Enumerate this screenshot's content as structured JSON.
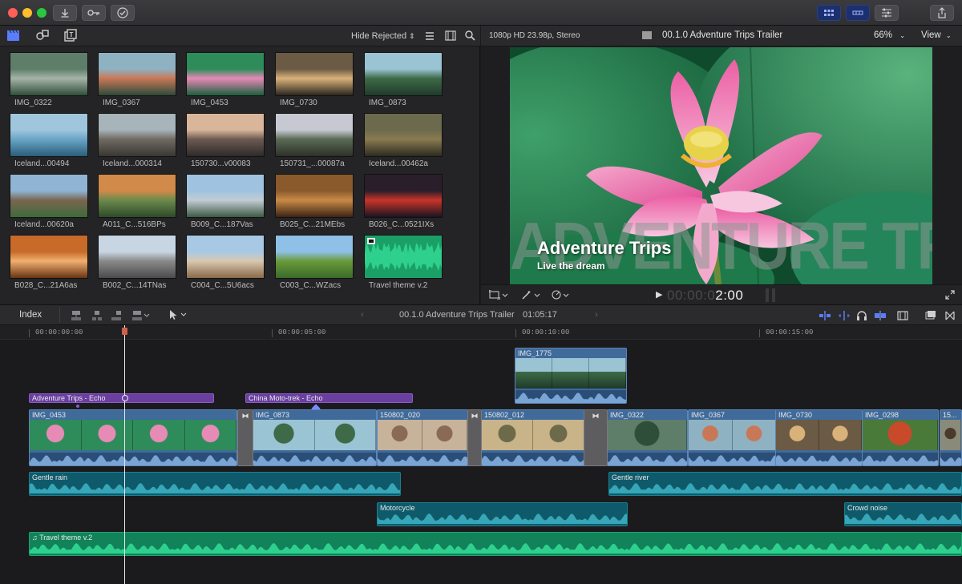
{
  "window": {
    "colors": {
      "close": "#ff5f57",
      "minimize": "#febc2e",
      "zoom": "#28c840",
      "accent": "#2c3f80"
    }
  },
  "toolbar": {
    "icons": [
      "import-icon",
      "key-icon",
      "check-icon",
      "browser-layout-icon",
      "timeline-layout-icon",
      "inspector-icon",
      "share-icon"
    ]
  },
  "browser": {
    "filter_label": "Hide Rejected",
    "clips": [
      {
        "label": "IMG_0322",
        "colors": [
          "#5f7e6a",
          "#a5b4a8",
          "#2f4e3a"
        ]
      },
      {
        "label": "IMG_0367",
        "colors": [
          "#8fb2c2",
          "#c87856",
          "#2d4a3b"
        ]
      },
      {
        "label": "IMG_0453",
        "colors": [
          "#2e8c5a",
          "#e68ab6",
          "#1b5f3d"
        ]
      },
      {
        "label": "IMG_0730",
        "colors": [
          "#6b5a44",
          "#d9b27a",
          "#2b2520"
        ]
      },
      {
        "label": "IMG_0873",
        "colors": [
          "#9ac3d4",
          "#3e6a48",
          "#1f3a2a"
        ]
      },
      {
        "label": "Iceland...00494",
        "colors": [
          "#9fc6dc",
          "#6aa5c7",
          "#2a5d7a"
        ]
      },
      {
        "label": "Iceland...000314",
        "colors": [
          "#a7b4b9",
          "#6f6a62",
          "#3a3632"
        ]
      },
      {
        "label": "150730...v00083",
        "colors": [
          "#d9b69a",
          "#6d5a52",
          "#2d2a2a"
        ]
      },
      {
        "label": "150731_...00087a",
        "colors": [
          "#c7c9d2",
          "#5a6a55",
          "#2d3129"
        ]
      },
      {
        "label": "Iceland...00462a",
        "colors": [
          "#6c6a4c",
          "#8a7a50",
          "#2c2b20"
        ]
      },
      {
        "label": "Iceland...00620a",
        "colors": [
          "#8fb4d4",
          "#7a6650",
          "#3e6a3a"
        ]
      },
      {
        "label": "A011_C...516BPs",
        "colors": [
          "#d18a4a",
          "#6b8a4c",
          "#2e4a2a"
        ]
      },
      {
        "label": "B009_C...187Vas",
        "colors": [
          "#9fc2e0",
          "#c2ccd4",
          "#3d5a44"
        ]
      },
      {
        "label": "B025_C...21MEbs",
        "colors": [
          "#8a5a2c",
          "#c98a48",
          "#3b2414"
        ]
      },
      {
        "label": "B026_C...0521IXs",
        "colors": [
          "#2a1e2a",
          "#c8342a",
          "#1a1420"
        ]
      },
      {
        "label": "B028_C...21A6as",
        "colors": [
          "#c86a2a",
          "#f0b070",
          "#6a3414"
        ]
      },
      {
        "label": "B002_C...14TNas",
        "colors": [
          "#c8d6e4",
          "#8a8a8a",
          "#4a4a4a"
        ]
      },
      {
        "label": "C004_C...5U6acs",
        "colors": [
          "#a7c9e4",
          "#d8c8b0",
          "#8a6a4a"
        ]
      },
      {
        "label": "C003_C...WZacs",
        "colors": [
          "#8fc0e8",
          "#6a9a3a",
          "#3a6a2a"
        ]
      },
      {
        "label": "Travel theme v.2",
        "colors": [
          "#1aa066",
          "#23c07c",
          "#117a4e"
        ]
      }
    ]
  },
  "viewer": {
    "format": "1080p HD 23.98p, Stereo",
    "project_title": "00.1.0 Adventure Trips Trailer",
    "zoom": "66%",
    "view_label": "View",
    "title_big": "Adventure Trips",
    "subtitle": "Live the dream",
    "watermark": "ADVENTURE TRIPS",
    "timecode_dim": "00:00:0",
    "timecode_bright": "2:00"
  },
  "timeline": {
    "index_label": "Index",
    "project_title": "00.1.0 Adventure Trips Trailer",
    "duration": "01:05:17",
    "ruler": [
      "00:00:00:00",
      "00:00:05:00",
      "00:00:10:00",
      "00:00:15:00"
    ],
    "connected_clip": "IMG_1775",
    "echo_titles": [
      "Adventure Trips - Echo",
      "China Moto-trek - Echo"
    ],
    "primary_clips": [
      "IMG_0453",
      "IMG_0873",
      "150802_020",
      "150802_012",
      "IMG_0322",
      "IMG_0367",
      "IMG_0730",
      "IMG_0298",
      "15..."
    ],
    "audio_clips": [
      "Gentle rain",
      "Gentle river",
      "Motorcycle",
      "Crowd noise"
    ],
    "music_clip": "Travel theme v.2"
  }
}
